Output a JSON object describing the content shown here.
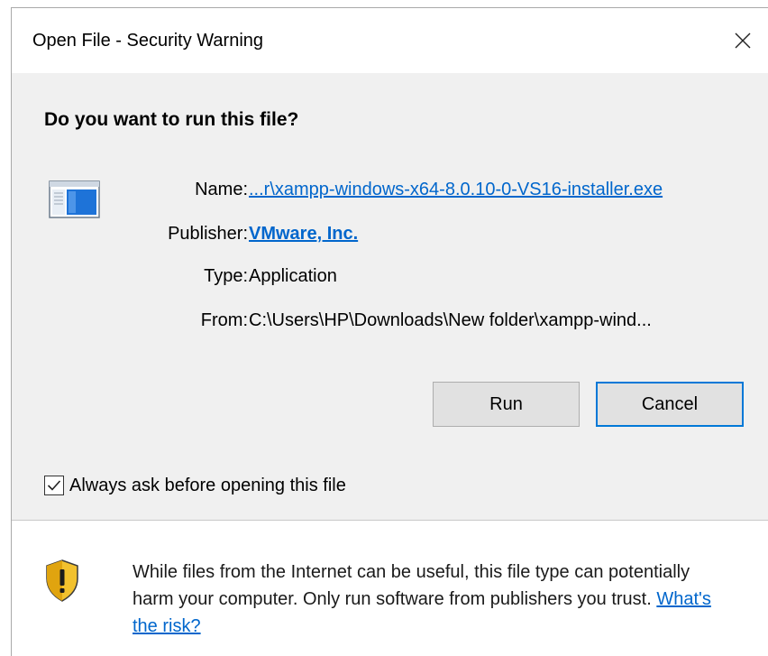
{
  "window": {
    "title": "Open File - Security Warning",
    "close_label": "Close"
  },
  "dialog": {
    "question": "Do you want to run this file?",
    "fields": {
      "name_label": "Name:",
      "name_value": "...r\\xampp-windows-x64-8.0.10-0-VS16-installer.exe",
      "publisher_label": "Publisher:",
      "publisher_value": "VMware, Inc.",
      "type_label": "Type:",
      "type_value": "Application",
      "from_label": "From:",
      "from_value": "C:\\Users\\HP\\Downloads\\New folder\\xampp-wind..."
    },
    "buttons": {
      "run": "Run",
      "cancel": "Cancel"
    },
    "checkbox": {
      "label": "Always ask before opening this file",
      "checked": true
    },
    "warning": {
      "text": "While files from the Internet can be useful, this file type can potentially harm your computer. Only run software from publishers you trust.",
      "link": "What's the risk?"
    }
  },
  "colors": {
    "link": "#0066cc",
    "accent_border": "#0078d7",
    "dialog_bg": "#f0f0f0"
  },
  "icons": [
    "application-file-icon",
    "close-icon",
    "checkmark-icon",
    "security-shield-icon"
  ]
}
